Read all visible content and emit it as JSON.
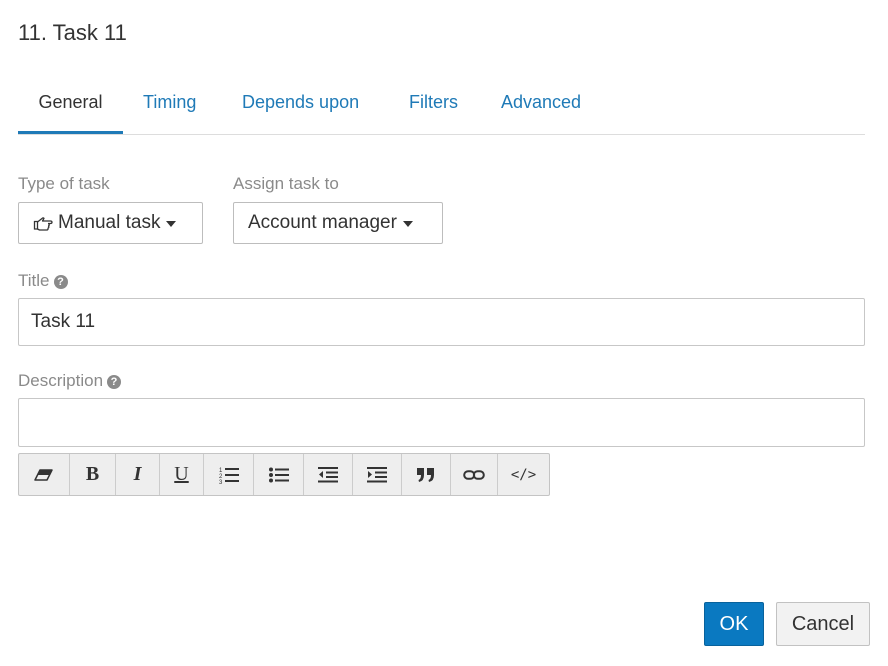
{
  "dialog": {
    "title": "11. Task 11"
  },
  "tabs": [
    {
      "label": "General",
      "active": true
    },
    {
      "label": "Timing",
      "active": false
    },
    {
      "label": "Depends upon",
      "active": false
    },
    {
      "label": "Filters",
      "active": false
    },
    {
      "label": "Advanced",
      "active": false
    }
  ],
  "type_of_task": {
    "label": "Type of task",
    "value": "Manual task",
    "icon": "hand-pointer-icon"
  },
  "assign_task_to": {
    "label": "Assign task to",
    "value": "Account manager"
  },
  "title_field": {
    "label": "Title",
    "value": "Task 11",
    "help_icon": "question-circle-icon"
  },
  "description_field": {
    "label": "Description",
    "value": "",
    "help_icon": "question-circle-icon"
  },
  "toolbar": {
    "buttons": [
      {
        "name": "eraser-icon",
        "glyph": ""
      },
      {
        "name": "bold-icon",
        "glyph": "B"
      },
      {
        "name": "italic-icon",
        "glyph": "I"
      },
      {
        "name": "underline-icon",
        "glyph": "U"
      },
      {
        "name": "ordered-list-icon",
        "glyph": ""
      },
      {
        "name": "unordered-list-icon",
        "glyph": ""
      },
      {
        "name": "outdent-icon",
        "glyph": ""
      },
      {
        "name": "indent-icon",
        "glyph": ""
      },
      {
        "name": "quote-icon",
        "glyph": ""
      },
      {
        "name": "link-icon",
        "glyph": ""
      },
      {
        "name": "code-icon",
        "glyph": "</>"
      }
    ]
  },
  "footer": {
    "ok_label": "OK",
    "cancel_label": "Cancel"
  },
  "colors": {
    "accent": "#1f7ab7",
    "primary_button": "#0a79c1",
    "muted_label": "#8a8a8a"
  }
}
